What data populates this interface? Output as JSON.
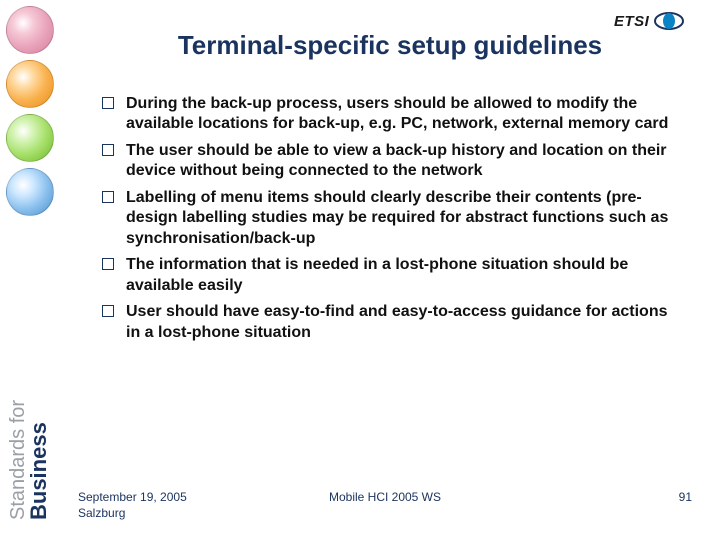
{
  "logo_text": "ETSI",
  "title": "Terminal-specific setup guidelines",
  "bullets": [
    "During the back-up process, users should be allowed to modify the available locations for back-up, e.g. PC, network, external memory card",
    "The user should be able to view a back-up history and location on their device without being connected to the network",
    "Labelling of menu items should clearly describe their contents (pre-design labelling studies may be required for abstract functions such as synchronisation/back-up",
    "The information that is needed in a lost-phone situation should be available easily",
    "User should have easy-to-find and easy-to-access guidance for actions in a lost-phone situation"
  ],
  "footer": {
    "date_line1": "September 19, 2005",
    "date_line2": "Salzburg",
    "center": "Mobile HCI 2005 WS",
    "page": "91"
  },
  "sidebar_caption_line1": "Standards for",
  "sidebar_caption_line2": "Business"
}
